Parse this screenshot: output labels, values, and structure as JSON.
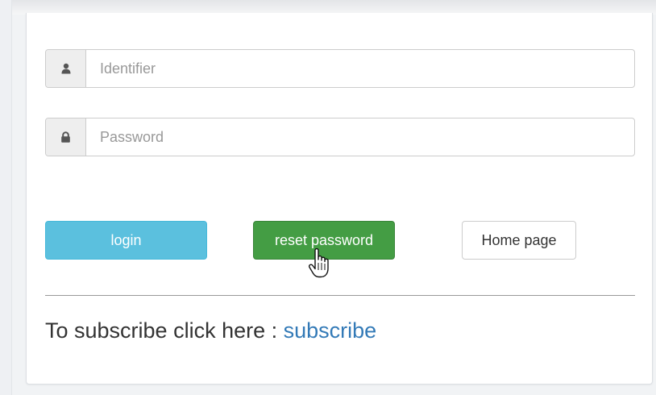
{
  "form": {
    "identifier": {
      "icon": "user-icon",
      "placeholder": "Identifier",
      "value": ""
    },
    "password": {
      "icon": "lock-icon",
      "placeholder": "Password",
      "value": ""
    }
  },
  "buttons": {
    "login_label": "login",
    "reset_label": "reset password",
    "home_label": "Home page"
  },
  "subscribe": {
    "prefix": "To subscribe click here : ",
    "link_label": "subscribe"
  },
  "colors": {
    "login": "#5bc0de",
    "reset": "#449d44",
    "link": "#337ab7"
  },
  "cursor": {
    "icon": "hand-pointer-icon"
  }
}
